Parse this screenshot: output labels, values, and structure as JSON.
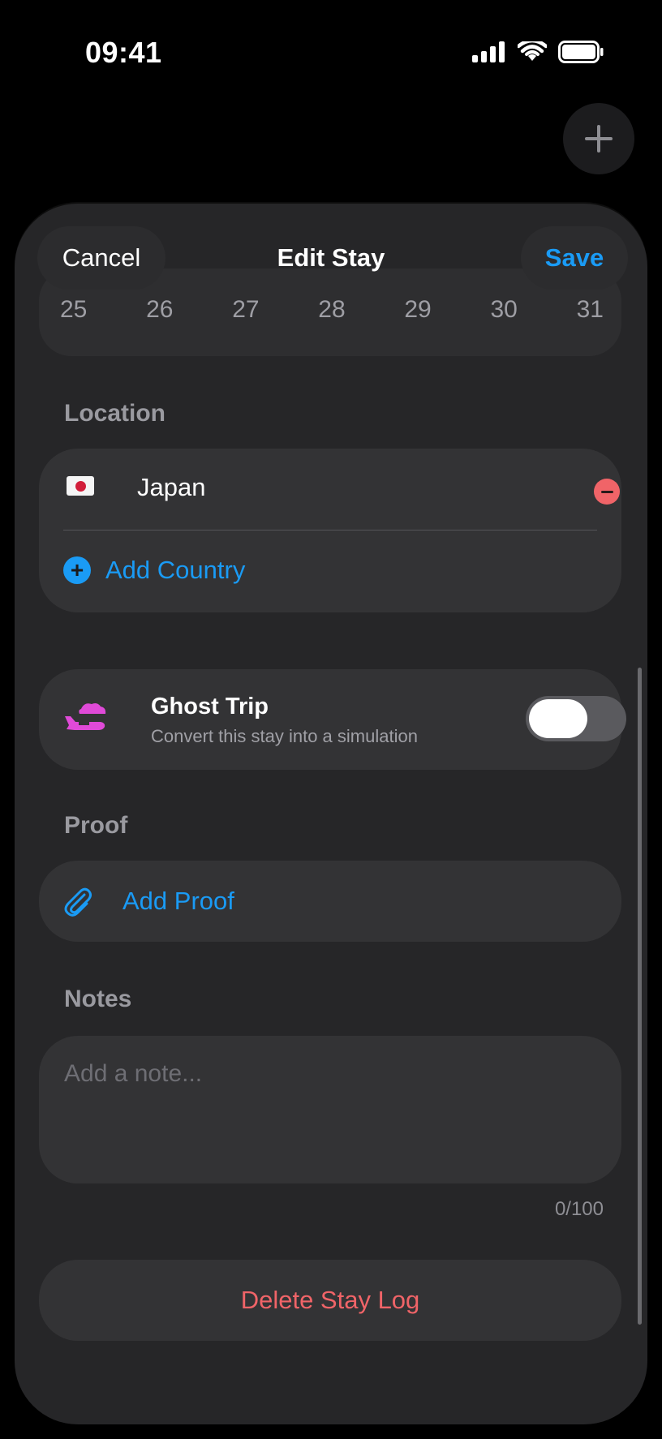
{
  "status": {
    "time": "09:41"
  },
  "sheet": {
    "cancel_label": "Cancel",
    "title": "Edit Stay",
    "save_label": "Save",
    "dates": [
      "25",
      "26",
      "27",
      "28",
      "29",
      "30",
      "31"
    ]
  },
  "location": {
    "label": "Location",
    "country": "Japan",
    "add_country_label": "Add Country"
  },
  "ghost_trip": {
    "title": "Ghost Trip",
    "subtitle": "Convert this stay into a simulation",
    "enabled": false
  },
  "proof": {
    "label": "Proof",
    "add_label": "Add Proof"
  },
  "notes": {
    "label": "Notes",
    "placeholder": "Add a note...",
    "counter": "0/100"
  },
  "delete_label": "Delete Stay Log",
  "colors": {
    "accent": "#1a9bf5",
    "destructive": "#f06468",
    "ghost_icon": "#e04ad8",
    "sheet_bg": "#262628"
  }
}
